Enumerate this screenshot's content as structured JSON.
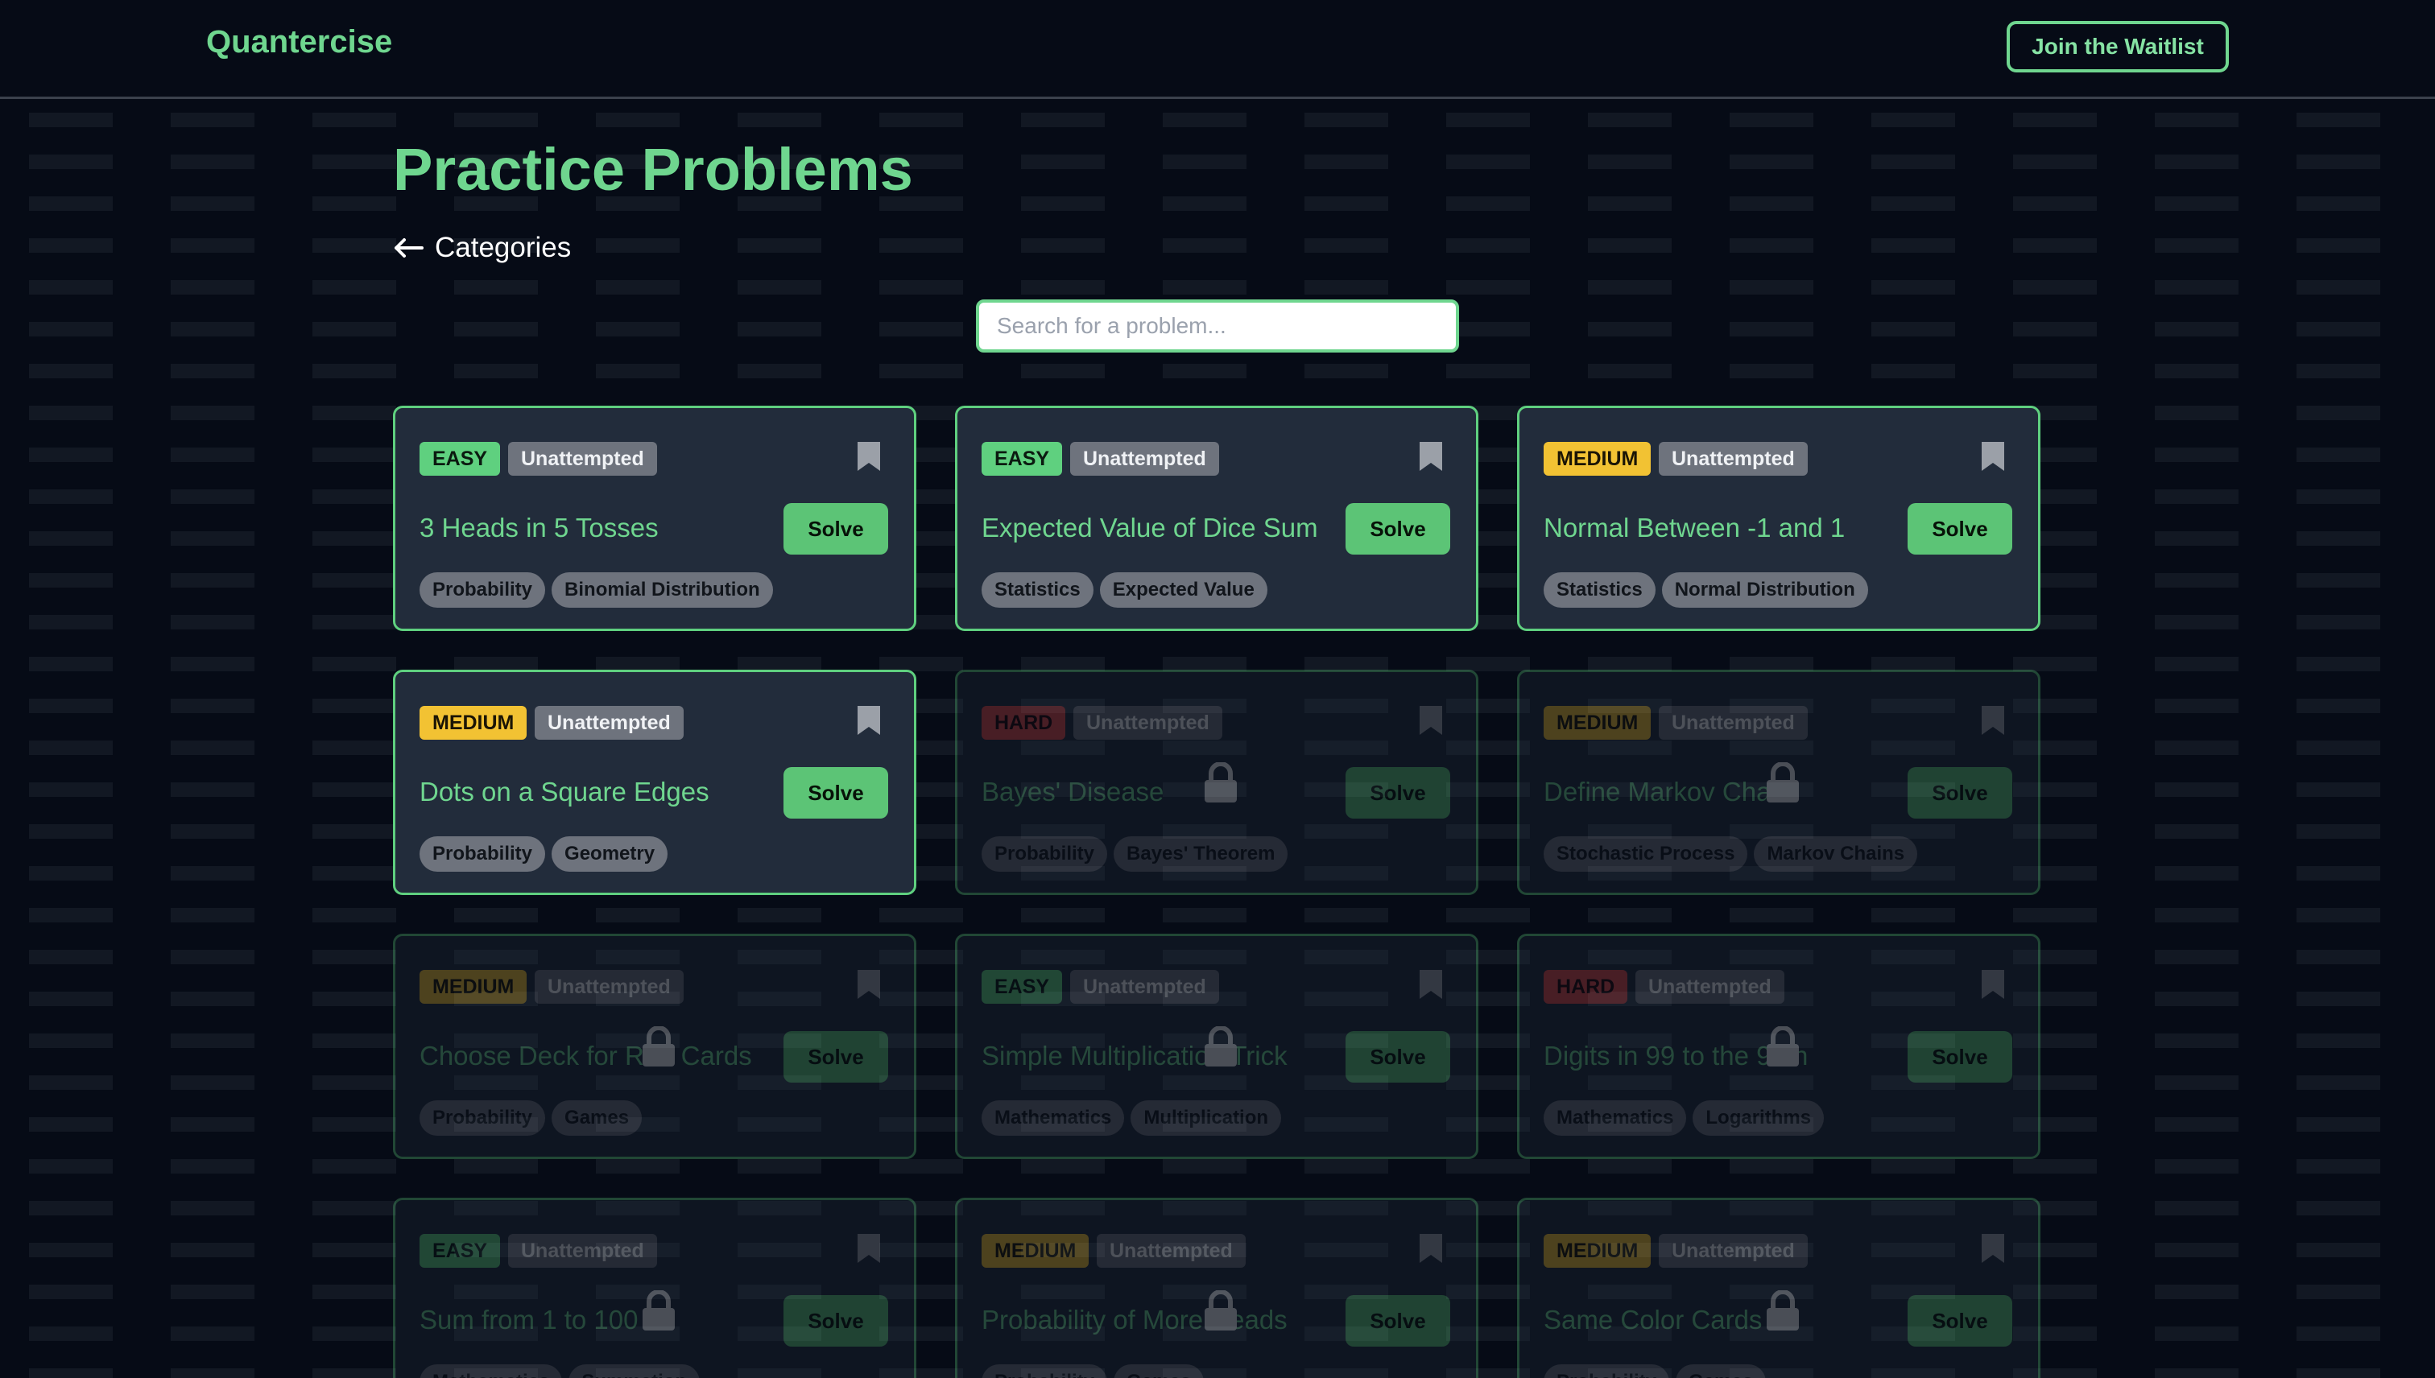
{
  "header": {
    "brand": "Quantercise",
    "waitlist_label": "Join the Waitlist"
  },
  "page": {
    "title": "Practice Problems",
    "back_label": "Categories"
  },
  "search": {
    "placeholder": "Search for a problem..."
  },
  "colors": {
    "accent": "#6fd68f",
    "easy": "#5fd07f",
    "medium": "#f2c233",
    "hard": "#e04a4a",
    "card_bg": "#222c3b",
    "page_bg": "#060b16"
  },
  "solve_label": "Solve",
  "problems": [
    {
      "title": "3 Heads in 5 Tosses",
      "difficulty": "EASY",
      "status": "Unattempted",
      "tags": [
        "Probability",
        "Binomial Distribution"
      ],
      "locked": false
    },
    {
      "title": "Expected Value of Dice Sum",
      "difficulty": "EASY",
      "status": "Unattempted",
      "tags": [
        "Statistics",
        "Expected Value"
      ],
      "locked": false
    },
    {
      "title": "Normal Between -1 and 1",
      "difficulty": "MEDIUM",
      "status": "Unattempted",
      "tags": [
        "Statistics",
        "Normal Distribution"
      ],
      "locked": false
    },
    {
      "title": "Dots on a Square Edges",
      "difficulty": "MEDIUM",
      "status": "Unattempted",
      "tags": [
        "Probability",
        "Geometry"
      ],
      "locked": false
    },
    {
      "title": "Bayes' Disease",
      "difficulty": "HARD",
      "status": "Unattempted",
      "tags": [
        "Probability",
        "Bayes' Theorem"
      ],
      "locked": true
    },
    {
      "title": "Define Markov Chain",
      "difficulty": "MEDIUM",
      "status": "Unattempted",
      "tags": [
        "Stochastic Process",
        "Markov Chains"
      ],
      "locked": true
    },
    {
      "title": "Choose Deck for Red Cards",
      "difficulty": "MEDIUM",
      "status": "Unattempted",
      "tags": [
        "Probability",
        "Games"
      ],
      "locked": true
    },
    {
      "title": "Simple Multiplication Trick",
      "difficulty": "EASY",
      "status": "Unattempted",
      "tags": [
        "Mathematics",
        "Multiplication"
      ],
      "locked": true
    },
    {
      "title": "Digits in 99 to the 99th",
      "difficulty": "HARD",
      "status": "Unattempted",
      "tags": [
        "Mathematics",
        "Logarithms"
      ],
      "locked": true
    },
    {
      "title": "Sum from 1 to 100",
      "difficulty": "EASY",
      "status": "Unattempted",
      "tags": [
        "Mathematics",
        "Summation"
      ],
      "locked": true
    },
    {
      "title": "Probability of More Heads",
      "difficulty": "MEDIUM",
      "status": "Unattempted",
      "tags": [
        "Probability",
        "Games"
      ],
      "locked": true
    },
    {
      "title": "Same Color Cards",
      "difficulty": "MEDIUM",
      "status": "Unattempted",
      "tags": [
        "Probability",
        "Games"
      ],
      "locked": true
    }
  ]
}
